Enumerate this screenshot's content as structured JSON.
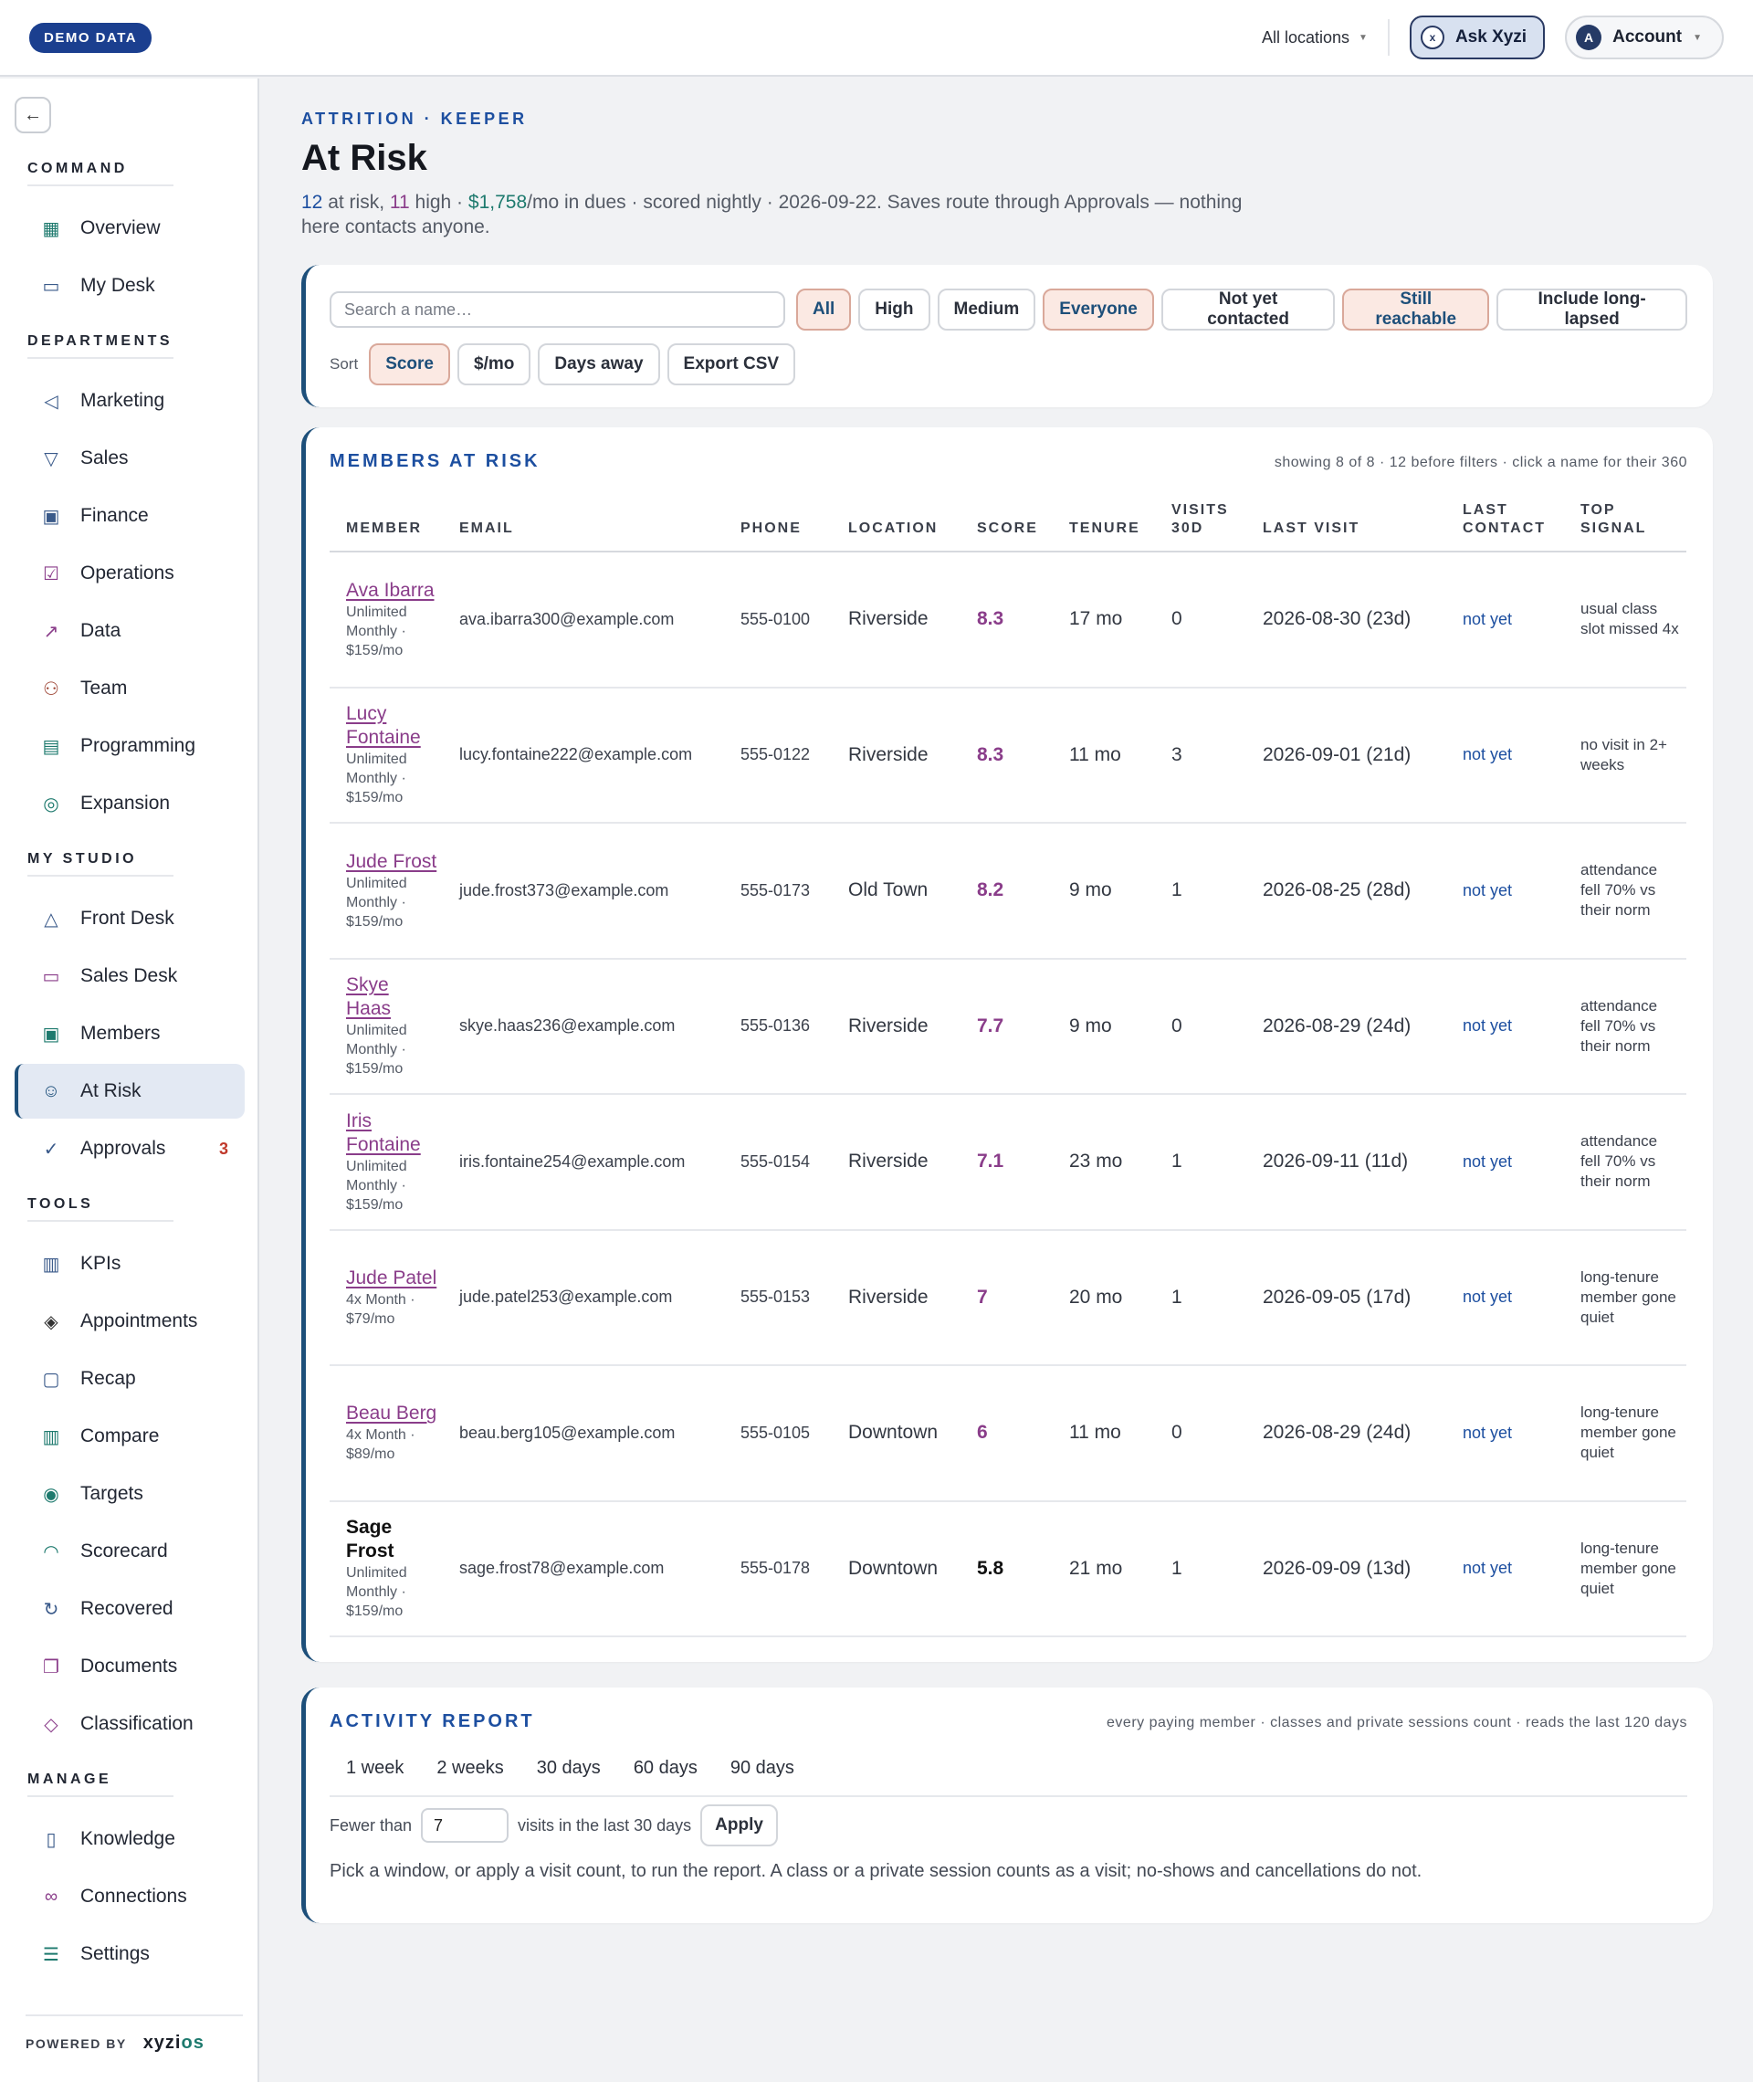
{
  "topbar": {
    "demo_badge": "DEMO DATA",
    "location": "All locations",
    "ask": "Ask Xyzi",
    "ask_icon_glyph": "x",
    "account": "Account",
    "avatar_letter": "A"
  },
  "sidebar": {
    "back_icon": "arrow-left-icon",
    "sections": {
      "command": "COMMAND",
      "departments": "DEPARTMENTS",
      "my_studio": "MY STUDIO",
      "tools": "TOOLS",
      "manage": "MANAGE"
    },
    "items": [
      {
        "label": "Overview",
        "icon": "grid-icon"
      },
      {
        "label": "My Desk",
        "icon": "inbox-icon"
      },
      {
        "label": "Marketing",
        "icon": "megaphone-icon"
      },
      {
        "label": "Sales",
        "icon": "funnel-icon"
      },
      {
        "label": "Finance",
        "icon": "cash-icon"
      },
      {
        "label": "Operations",
        "icon": "clipboard-icon"
      },
      {
        "label": "Data",
        "icon": "line-chart-icon"
      },
      {
        "label": "Team",
        "icon": "people-icon"
      },
      {
        "label": "Programming",
        "icon": "calendar-icon"
      },
      {
        "label": "Expansion",
        "icon": "compass-icon"
      },
      {
        "label": "Front Desk",
        "icon": "bell-icon"
      },
      {
        "label": "Sales Desk",
        "icon": "chat-icon"
      },
      {
        "label": "Members",
        "icon": "id-card-icon"
      },
      {
        "label": "At Risk",
        "icon": "user-alert-icon"
      },
      {
        "label": "Approvals",
        "icon": "check-circle-icon",
        "count": "3"
      },
      {
        "label": "KPIs",
        "icon": "bar-chart-icon"
      },
      {
        "label": "Appointments",
        "icon": "layers-icon"
      },
      {
        "label": "Recap",
        "icon": "report-icon"
      },
      {
        "label": "Compare",
        "icon": "columns-icon"
      },
      {
        "label": "Targets",
        "icon": "target-icon"
      },
      {
        "label": "Scorecard",
        "icon": "gauge-icon"
      },
      {
        "label": "Recovered",
        "icon": "refresh-dollar-icon"
      },
      {
        "label": "Documents",
        "icon": "documents-icon"
      },
      {
        "label": "Classification",
        "icon": "tag-icon"
      },
      {
        "label": "Knowledge",
        "icon": "book-icon"
      },
      {
        "label": "Connections",
        "icon": "link-icon"
      },
      {
        "label": "Settings",
        "icon": "sliders-icon"
      }
    ],
    "powered_by": "POWERED BY",
    "logo_main": "xyzi",
    "logo_accent": "os"
  },
  "header": {
    "eyebrow": "ATTRITION · KEEPER",
    "title": "At Risk",
    "sub_n1": "12",
    "sub_t1": " at risk, ",
    "sub_n2": "11",
    "sub_t2": " high · ",
    "sub_n3": "$1,758",
    "sub_t3": "/mo in dues · scored nightly · 2026-09-22. Saves route through Approvals — nothing here contacts anyone."
  },
  "filters": {
    "search_placeholder": "Search a name…",
    "chips": [
      "All",
      "High",
      "Medium",
      "Everyone",
      "Not yet contacted",
      "Still reachable",
      "Include long-lapsed"
    ],
    "sort_label": "Sort",
    "sort_chips": [
      "Score",
      "$/mo",
      "Days away"
    ],
    "export": "Export CSV"
  },
  "table": {
    "title": "MEMBERS AT RISK",
    "note": "showing 8 of 8 · 12 before filters · click a name for their 360",
    "columns": [
      "MEMBER",
      "EMAIL",
      "PHONE",
      "LOCATION",
      "SCORE",
      "TENURE",
      "VISITS 30D",
      "LAST VISIT",
      "LAST CONTACT",
      "TOP SIGNAL"
    ],
    "rows": [
      {
        "name": "Ava Ibarra",
        "plan": "Unlimited Monthly · $159/mo",
        "email": "ava.ibarra300@example.com",
        "phone": "555-0100",
        "location": "Riverside",
        "score": "8.3",
        "tenure": "17 mo",
        "visits": "0",
        "last_visit": "2026-08-30 (23d)",
        "contact": "not yet",
        "signal": "usual class slot missed 4x"
      },
      {
        "name": "Lucy Fontaine",
        "plan": "Unlimited Monthly · $159/mo",
        "email": "lucy.fontaine222@example.com",
        "phone": "555-0122",
        "location": "Riverside",
        "score": "8.3",
        "tenure": "11 mo",
        "visits": "3",
        "last_visit": "2026-09-01 (21d)",
        "contact": "not yet",
        "signal": "no visit in 2+ weeks"
      },
      {
        "name": "Jude Frost",
        "plan": "Unlimited Monthly · $159/mo",
        "email": "jude.frost373@example.com",
        "phone": "555-0173",
        "location": "Old Town",
        "score": "8.2",
        "tenure": "9 mo",
        "visits": "1",
        "last_visit": "2026-08-25 (28d)",
        "contact": "not yet",
        "signal": "attendance fell 70% vs their norm"
      },
      {
        "name": "Skye Haas",
        "plan": "Unlimited Monthly · $159/mo",
        "email": "skye.haas236@example.com",
        "phone": "555-0136",
        "location": "Riverside",
        "score": "7.7",
        "tenure": "9 mo",
        "visits": "0",
        "last_visit": "2026-08-29 (24d)",
        "contact": "not yet",
        "signal": "attendance fell 70% vs their norm"
      },
      {
        "name": "Iris Fontaine",
        "plan": "Unlimited Monthly · $159/mo",
        "email": "iris.fontaine254@example.com",
        "phone": "555-0154",
        "location": "Riverside",
        "score": "7.1",
        "tenure": "23 mo",
        "visits": "1",
        "last_visit": "2026-09-11 (11d)",
        "contact": "not yet",
        "signal": "attendance fell 70% vs their norm"
      },
      {
        "name": "Jude Patel",
        "plan": "4x Month · $79/mo",
        "email": "jude.patel253@example.com",
        "phone": "555-0153",
        "location": "Riverside",
        "score": "7",
        "tenure": "20 mo",
        "visits": "1",
        "last_visit": "2026-09-05 (17d)",
        "contact": "not yet",
        "signal": "long-tenure member gone quiet"
      },
      {
        "name": "Beau Berg",
        "plan": "4x Month · $89/mo",
        "email": "beau.berg105@example.com",
        "phone": "555-0105",
        "location": "Downtown",
        "score": "6",
        "tenure": "11 mo",
        "visits": "0",
        "last_visit": "2026-08-29 (24d)",
        "contact": "not yet",
        "signal": "long-tenure member gone quiet"
      },
      {
        "name": "Sage Frost",
        "plan": "Unlimited Monthly · $159/mo",
        "email": "sage.frost78@example.com",
        "phone": "555-0178",
        "location": "Downtown",
        "score": "5.8",
        "tenure": "21 mo",
        "visits": "1",
        "last_visit": "2026-09-09 (13d)",
        "contact": "not yet",
        "signal": "long-tenure member gone quiet"
      }
    ]
  },
  "activity": {
    "title": "ACTIVITY REPORT",
    "note": "every paying member · classes and private sessions count · reads the last 120 days",
    "tabs": [
      "1 week",
      "2 weeks",
      "30 days",
      "60 days",
      "90 days"
    ],
    "fewer_than": "Fewer than",
    "visits_value": "7",
    "visits_suffix": "visits in the last 30 days",
    "apply": "Apply",
    "help": "Pick a window, or apply a visit count, to run the report. A class or a private session counts as a visit; no-shows and cancellations do not."
  }
}
